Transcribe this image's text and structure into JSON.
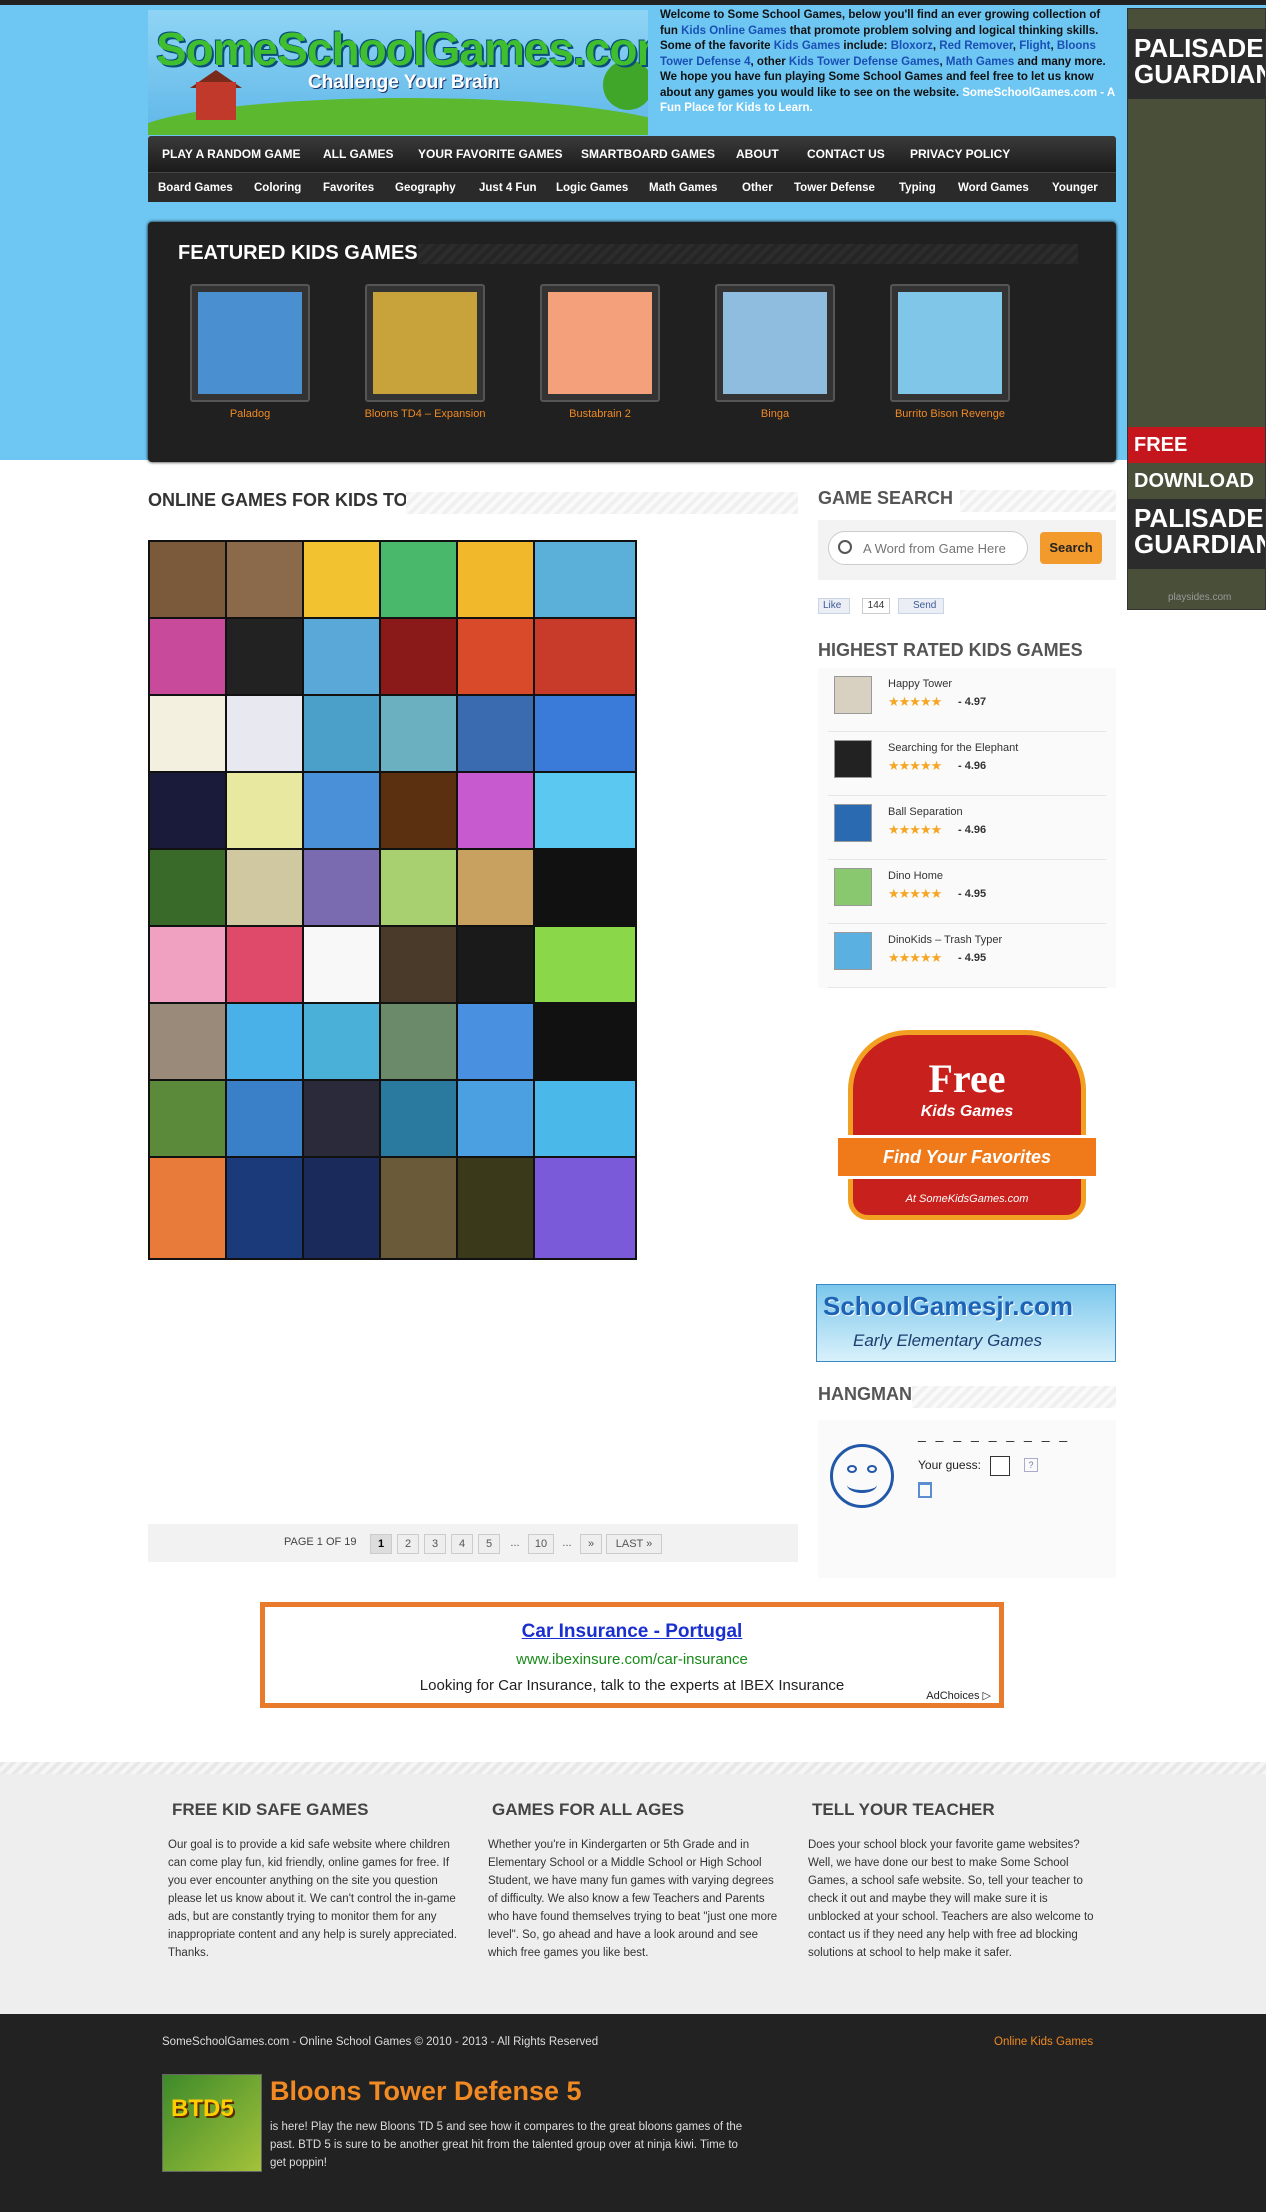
{
  "site": {
    "logo_text": "SomeSchoolGames.com",
    "logo_tagline": "Challenge Your Brain",
    "intro": {
      "p1": "Welcome to Some School Games, below you'll find an ever growing collection of fun ",
      "kids_games": "Kids Online Games",
      "p2": " that promote problem solving and logical thinking skills. Some of the favorite ",
      "kids_games2": "Kids Games",
      "p3": " include: ",
      "g1": "Bloxorz",
      "sep1": ", ",
      "g2": "Red Remover",
      "sep2": ", ",
      "g3": "Flight",
      "sep3": ", ",
      "g4": "Bloons Tower Defense 4",
      "p4": ", other ",
      "g5": "Kids Tower Defense Games",
      "sep5": ", ",
      "g6": "Math Games",
      "p5": " and many more. We hope you have fun playing Some School Games and feel free to let us know about any games you would like to see on the website.",
      "sitename": "SomeSchoolGames.com - A Fun Place for Kids to Learn."
    }
  },
  "main_nav": [
    "PLAY A RANDOM GAME",
    "ALL GAMES",
    "YOUR FAVORITE GAMES",
    "SMARTBOARD GAMES",
    "ABOUT",
    "CONTACT US",
    "PRIVACY POLICY"
  ],
  "sub_nav": [
    "Board Games",
    "Coloring",
    "Favorites",
    "Geography",
    "Just 4 Fun",
    "Logic Games",
    "Math Games",
    "Other",
    "Tower Defense",
    "Typing",
    "Word Games",
    "Younger"
  ],
  "featured": {
    "title": "FEATURED KIDS GAMES",
    "items": [
      {
        "label": "Paladog",
        "color": "#4a8fd0"
      },
      {
        "label": "Bloons TD4 – Expansion",
        "color": "#c8a23a"
      },
      {
        "label": "Bustabrain 2",
        "color": "#f4a07a"
      },
      {
        "label": "Binga",
        "color": "#8fbde0"
      },
      {
        "label": "Burrito Bison Revenge",
        "color": "#7fc6e8"
      }
    ]
  },
  "right_ad": {
    "head1": "PALISADE GUARDIAN",
    "red": "FREE DOWNLOAD",
    "head2": "PALISADE GUARDIAN",
    "source": "playsides.com"
  },
  "games": {
    "title": "ONLINE GAMES FOR KIDS TO PLAY AT SCHOOL",
    "thumbs": [
      "#7a5a3a",
      "#8a6a4a",
      "#f2c230",
      "#4ab86a",
      "#f0b82a",
      "#5ab0d8",
      "#c84a9a",
      "#222222",
      "#5aa8d8",
      "#8a1a1a",
      "#d84a2a",
      "#c83a2a",
      "#f4f0e0",
      "#e8e8f0",
      "#4aa0c8",
      "#6ab0c0",
      "#3a6ab0",
      "#3a7ad8",
      "#1a1a3a",
      "#e8e8a0",
      "#4a90d8",
      "#5a3010",
      "#c85ad0",
      "#5ac8f0",
      "#3a6a2a",
      "#d0c8a0",
      "#7a6ab0",
      "#a8d070",
      "#c8a060",
      "#111111",
      "#f0a0c0",
      "#e04a6a",
      "#f8f8f8",
      "#4a3a2a",
      "#1a1a1a",
      "#8ad84a",
      "#9a8a7a",
      "#4ab0e8",
      "#4ab0d8",
      "#6a8a6a",
      "#4a90e0",
      "#111111",
      "#5a8a3a",
      "#3a80c8",
      "#2a2a3a",
      "#2a7aa0",
      "#4aa0e0",
      "#4ab8e8",
      "#e87a3a",
      "#1a3a7a",
      "#1a2a5a",
      "#6a5a3a",
      "#3a3a1a",
      "#7a5ad8"
    ],
    "pager": {
      "label": "PAGE 1 OF 19",
      "pages": [
        "1",
        "2",
        "3",
        "4",
        "5",
        "...",
        "10",
        "...",
        "»",
        "LAST »"
      ]
    }
  },
  "sidebar": {
    "search_title": "GAME SEARCH",
    "search_placeholder": "A Word from Game Here",
    "search_button": "Search",
    "fb_like": "Like",
    "fb_count": "144",
    "fb_send": "Send",
    "rated_title": "HIGHEST RATED KIDS GAMES",
    "rated": [
      {
        "name": "Happy Tower",
        "score": "- 4.97",
        "stars": "★★★★★",
        "color": "#d8d0c0"
      },
      {
        "name": "Searching for the Elephant",
        "score": "- 4.96",
        "stars": "★★★★★",
        "color": "#222222"
      },
      {
        "name": "Ball Separation",
        "score": "- 4.96",
        "stars": "★★★★★",
        "color": "#2a6ab0"
      },
      {
        "name": "Dino Home",
        "score": "- 4.95",
        "stars": "★★★★★",
        "color": "#8ac870"
      },
      {
        "name": "DinoKids – Trash Typer",
        "score": "- 4.95",
        "stars": "★★★★★",
        "color": "#5ab0e0"
      }
    ],
    "free_ad": {
      "title": "Free",
      "sub": "Kids Games",
      "ribbon": "Find Your Favorites",
      "url": "At SomeKidsGames.com"
    },
    "jr_ad": {
      "title": "SchoolGamesjr.com",
      "sub": "Early Elementary Games"
    },
    "hangman_title": "HANGMAN",
    "hangman_blanks": "_ _ _ _ _ _ _ _ _",
    "hangman_guess": "Your guess:",
    "hangman_help": "?"
  },
  "banner_ad": {
    "title": "Car Insurance - Portugal",
    "url": "www.ibexinsure.com/car-insurance",
    "desc": "Looking for Car Insurance, talk to the experts at IBEX Insurance",
    "choices": "AdChoices ▷"
  },
  "footer": {
    "cols": [
      {
        "title": "FREE KID SAFE GAMES",
        "body": "Our goal is to provide a kid safe website where children can come play fun, kid friendly, online games for free. If you ever encounter anything on the site you question please let us know about it. We can't control the in-game ads, but are constantly trying to monitor them for any inappropriate content and any help is surely appreciated. Thanks."
      },
      {
        "title": "GAMES FOR ALL AGES",
        "body": "Whether you're in Kindergarten or 5th Grade and in Elementary School or a Middle School or High School Student, we have many fun games with varying degrees of difficulty. We also know a few Teachers and Parents who have found themselves trying to beat \"just one more level\". So, go ahead and have a look around and see which free games you like best."
      },
      {
        "title": "TELL YOUR TEACHER",
        "body": "Does your school block your favorite game websites? Well, we have done our best to make Some School Games, a school safe website. So, tell your teacher to check it out and maybe they will make sure it is unblocked at your school. Teachers are also welcome to contact us if they need any help with free ad blocking solutions at school to help make it safer."
      }
    ],
    "copyright": "SomeSchoolGames.com - Online School Games © 2010 - 2013 - All Rights Reserved",
    "link": "Online Kids Games",
    "btd_thumb": "BTD5",
    "btd_title": "Bloons Tower Defense 5",
    "btd_body": "is here! Play the new Bloons TD 5 and see how it compares to the great bloons games of the past. BTD 5 is sure to be another great hit from the talented group over at ninja kiwi. Time to get poppin!"
  }
}
